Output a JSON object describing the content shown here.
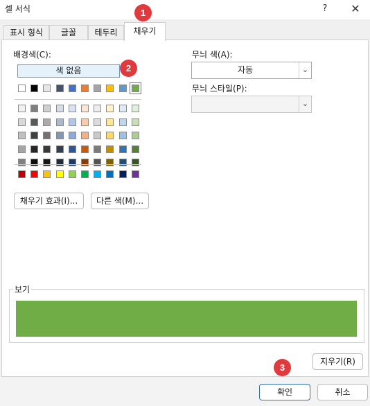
{
  "window": {
    "title": "셀 서식",
    "help_label": "?",
    "close_label": "✕"
  },
  "tabs": [
    {
      "label": "표시 형식",
      "active": false
    },
    {
      "label": "글꼴",
      "active": false
    },
    {
      "label": "테두리",
      "active": false
    },
    {
      "label": "채우기",
      "active": true
    }
  ],
  "fill": {
    "background_label": "배경색(C):",
    "no_color_label": "색 없음",
    "theme_row": [
      "#ffffff",
      "#000000",
      "#e7e6e6",
      "#44546a",
      "#4472c4",
      "#ed7d31",
      "#a5a5a5",
      "#ffc000",
      "#5b9bd5",
      "#70ad47"
    ],
    "tint_rows": [
      [
        "#f2f2f2",
        "#7f7f7f",
        "#d0cece",
        "#d6dce4",
        "#d9e1f2",
        "#fce4d6",
        "#ededed",
        "#fff2cc",
        "#ddebf7",
        "#e2efda"
      ],
      [
        "#d9d9d9",
        "#595959",
        "#aeaaaa",
        "#acb9ca",
        "#b4c6e7",
        "#f8cbad",
        "#dbdbdb",
        "#ffe699",
        "#bdd7ee",
        "#c6e0b4"
      ],
      [
        "#bfbfbf",
        "#404040",
        "#757171",
        "#8497b0",
        "#8ea9db",
        "#f4b084",
        "#c9c9c9",
        "#ffd966",
        "#9bc2e6",
        "#a9d08e"
      ],
      [
        "#a6a6a6",
        "#262626",
        "#3a3838",
        "#333f4f",
        "#2f5597",
        "#c65911",
        "#7b7b7b",
        "#bf8f00",
        "#2e75b6",
        "#548235"
      ],
      [
        "#808080",
        "#0d0d0d",
        "#161616",
        "#222b35",
        "#203864",
        "#843c0c",
        "#525252",
        "#806000",
        "#1f4e78",
        "#375623"
      ]
    ],
    "standard_row": [
      "#c00000",
      "#ff0000",
      "#ffc000",
      "#ffff00",
      "#92d050",
      "#00b050",
      "#00b0f0",
      "#0070c0",
      "#002060",
      "#7030a0"
    ],
    "selected_color": "#70ad47",
    "fill_effects_label": "채우기 효과(I)...",
    "more_colors_label": "다른 색(M)...",
    "pattern_color_label": "무늬 색(A):",
    "pattern_color_value": "자동",
    "pattern_style_label": "무늬 스타일(P):",
    "pattern_style_value": "",
    "preview_label": "보기",
    "preview_color": "#70ad47",
    "clear_label": "지우기(R)"
  },
  "footer": {
    "ok_label": "확인",
    "cancel_label": "취소"
  },
  "annotations": {
    "step1": "1",
    "step2": "2",
    "step3": "3",
    "color": "#e03a3e"
  }
}
